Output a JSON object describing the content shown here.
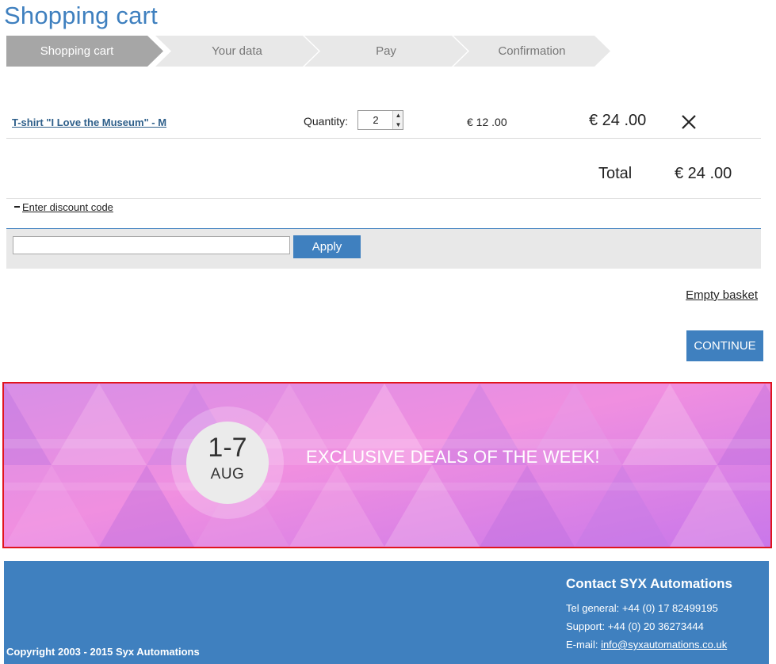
{
  "page": {
    "title": "Shopping cart"
  },
  "steps": [
    {
      "label": "Shopping cart",
      "active": true
    },
    {
      "label": "Your data",
      "active": false
    },
    {
      "label": "Pay",
      "active": false
    },
    {
      "label": "Confirmation",
      "active": false
    }
  ],
  "cart": {
    "item": {
      "name": "T-shirt \"I Love the Museum\" - M",
      "quantity_label": "Quantity:",
      "quantity": "2",
      "unit_price": "€ 12 .00",
      "line_total": "€ 24 .00"
    },
    "total_label": "Total",
    "total_value": "€ 24 .00"
  },
  "discount": {
    "toggle_label": "Enter discount code",
    "input_value": "",
    "apply_label": "Apply"
  },
  "actions": {
    "empty_basket": "Empty basket",
    "continue": "CONTINUE"
  },
  "banner": {
    "date_range": "1-7",
    "month": "AUG",
    "headline": "EXCLUSIVE DEALS OF THE WEEK!"
  },
  "footer": {
    "copyright": "Copyright 2003 - 2015 Syx Automations",
    "contact_title": "Contact SYX Automations",
    "tel_general": "Tel general: +44 (0) 17 82499195",
    "support": "Support: +44 (0) 20 36273444",
    "email_label": "E-mail: ",
    "email": "info@syxautomations.co.uk"
  },
  "colors": {
    "brand_blue": "#3f80bf",
    "step_active": "#a6a6a6",
    "step_inactive": "#e8e8e8",
    "banner_highlight": "#e0141e"
  }
}
